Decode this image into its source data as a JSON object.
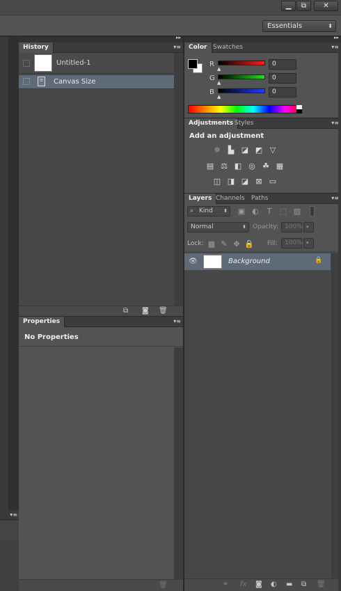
{
  "window": {
    "minimize_glyph": "▁",
    "restore_glyph": "⧉",
    "close_glyph": "✕"
  },
  "options_bar": {
    "workspace": "Essentials"
  },
  "history": {
    "tab": "History",
    "snapshot_label": "Untitled-1",
    "steps": [
      "Canvas Size"
    ]
  },
  "properties": {
    "tab": "Properties",
    "empty_label": "No Properties"
  },
  "color": {
    "tabs": [
      "Color",
      "Swatches"
    ],
    "channels": [
      {
        "label": "R",
        "value": "0",
        "color": "#ff2020"
      },
      {
        "label": "G",
        "value": "0",
        "color": "#20e020"
      },
      {
        "label": "B",
        "value": "0",
        "color": "#2040ff"
      }
    ],
    "foreground": "#000000",
    "background": "#ffffff"
  },
  "adjustments": {
    "tabs": [
      "Adjustments",
      "Styles"
    ],
    "heading": "Add an adjustment"
  },
  "layers": {
    "tabs": [
      "Layers",
      "Channels",
      "Paths"
    ],
    "filter_kind": "Kind",
    "blend_mode": "Normal",
    "opacity_label": "Opacity:",
    "opacity_value": "100%",
    "lock_label": "Lock:",
    "fill_label": "Fill:",
    "fill_value": "100%",
    "layer_name": "Background"
  }
}
